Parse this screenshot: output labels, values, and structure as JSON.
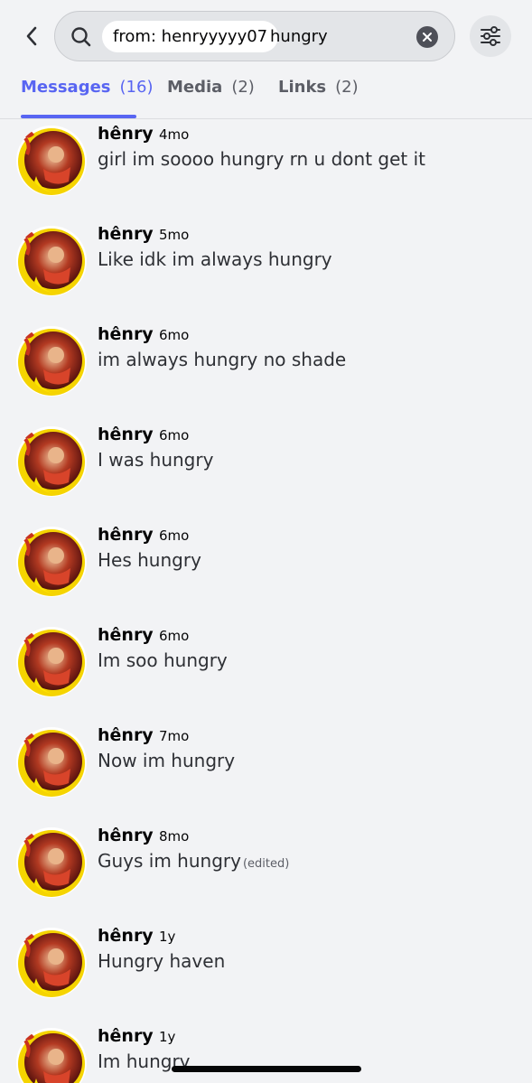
{
  "search": {
    "filter_chip": "from: henryyyyy07",
    "query": "hungry"
  },
  "tabs": [
    {
      "label": "Messages",
      "count": "(16)"
    },
    {
      "label": "Media",
      "count": "(2)"
    },
    {
      "label": "Links",
      "count": "(2)"
    }
  ],
  "messages": [
    {
      "author": "hênry",
      "time": "4mo",
      "content": "girl im soooo hungry rn u dont get it",
      "edited": ""
    },
    {
      "author": "hênry",
      "time": "5mo",
      "content": "Like idk im always hungry",
      "edited": ""
    },
    {
      "author": "hênry",
      "time": "6mo",
      "content": "im always hungry no shade",
      "edited": ""
    },
    {
      "author": "hênry",
      "time": "6mo",
      "content": "I was hungry",
      "edited": ""
    },
    {
      "author": "hênry",
      "time": "6mo",
      "content": "Hes hungry",
      "edited": ""
    },
    {
      "author": "hênry",
      "time": "6mo",
      "content": "Im soo hungry",
      "edited": ""
    },
    {
      "author": "hênry",
      "time": "7mo",
      "content": "Now im hungry",
      "edited": ""
    },
    {
      "author": "hênry",
      "time": "8mo",
      "content": "Guys im hungry",
      "edited": "(edited)"
    },
    {
      "author": "hênry",
      "time": "1y",
      "content": "Hungry haven",
      "edited": ""
    },
    {
      "author": "hênry",
      "time": "1y",
      "content": "Im hungry",
      "edited": ""
    }
  ],
  "icons": {
    "back": "chevron-left-icon",
    "search": "search-icon",
    "clear": "clear-x-icon",
    "settings": "sliders-icon"
  },
  "colors": {
    "accent": "#5865f2",
    "background": "#f2f3f5"
  }
}
